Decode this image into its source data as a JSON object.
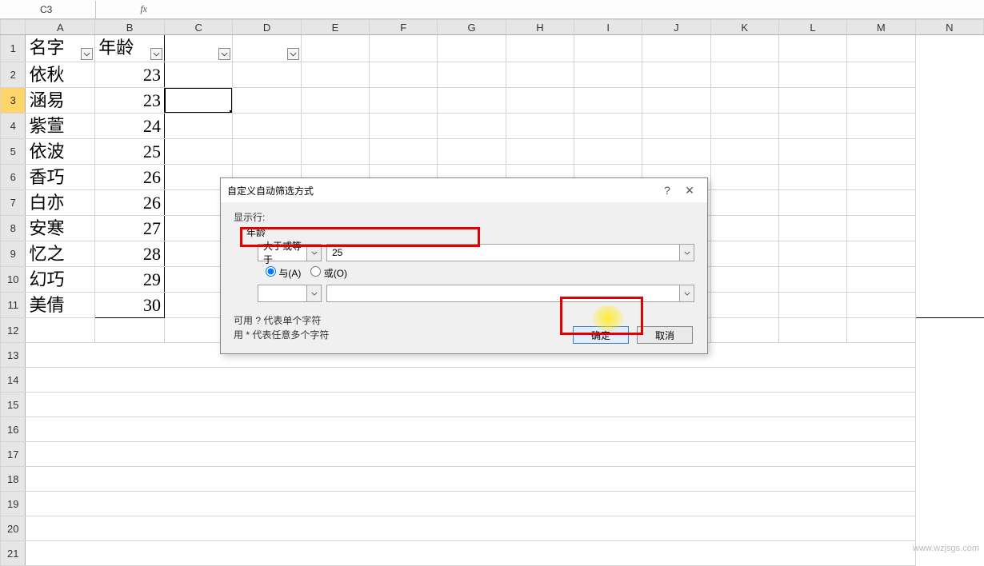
{
  "formula_bar": {
    "name_box": "C3",
    "fx_label": "fx",
    "value": ""
  },
  "columns": [
    "A",
    "B",
    "C",
    "D",
    "E",
    "F",
    "G",
    "H",
    "I",
    "J",
    "K",
    "L",
    "M",
    "N"
  ],
  "header_row": {
    "a": "名字",
    "b": "年龄"
  },
  "data_rows": [
    {
      "n": "2",
      "a": "依秋",
      "b": "23"
    },
    {
      "n": "3",
      "a": "涵易",
      "b": "23"
    },
    {
      "n": "4",
      "a": "紫萱",
      "b": "24"
    },
    {
      "n": "5",
      "a": "依波",
      "b": "25"
    },
    {
      "n": "6",
      "a": "香巧",
      "b": "26"
    },
    {
      "n": "7",
      "a": "白亦",
      "b": "26"
    },
    {
      "n": "8",
      "a": "安寒",
      "b": "27"
    },
    {
      "n": "9",
      "a": "忆之",
      "b": "28"
    },
    {
      "n": "10",
      "a": "幻巧",
      "b": "29"
    },
    {
      "n": "11",
      "a": "美倩",
      "b": "30"
    }
  ],
  "empty_rows": [
    "12",
    "13",
    "14",
    "15",
    "16",
    "17",
    "18",
    "19",
    "20",
    "21"
  ],
  "selected_cell": "C3",
  "dialog": {
    "title": "自定义自动筛选方式",
    "show_label": "显示行:",
    "field_label": "年龄",
    "condition1_op": "大于或等于",
    "condition1_val": "25",
    "and_label": "与(A)",
    "or_label": "或(O)",
    "condition2_op": "",
    "condition2_val": "",
    "help1": "可用 ? 代表单个字符",
    "help2": "用 * 代表任意多个字符",
    "ok": "确定",
    "cancel": "取消",
    "help_icon": "?",
    "close_icon": "✕"
  },
  "watermark": "www.wzjsgs.com"
}
